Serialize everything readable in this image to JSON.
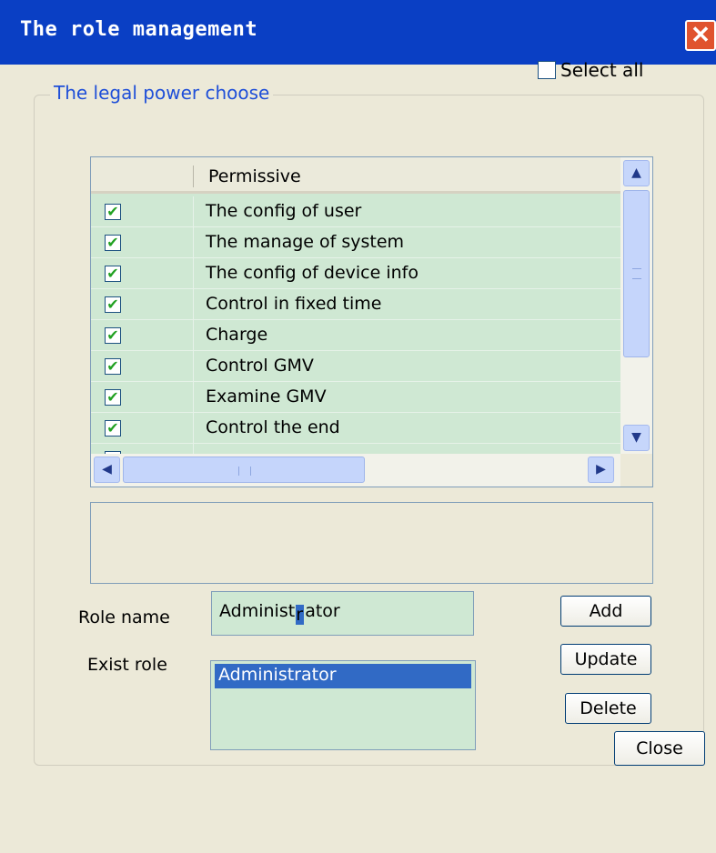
{
  "window": {
    "title": "The role management",
    "close_glyph": "✕"
  },
  "group": {
    "legend": "The legal power choose",
    "select_all_label": "Select all",
    "select_all_checked": false
  },
  "permissions": {
    "column_header": "Permissive",
    "items": [
      {
        "label": "The config of user",
        "checked": true
      },
      {
        "label": "The manage of system",
        "checked": true
      },
      {
        "label": "The config of device info",
        "checked": true
      },
      {
        "label": "Control in fixed time",
        "checked": true
      },
      {
        "label": "Charge",
        "checked": true
      },
      {
        "label": "Control GMV",
        "checked": true
      },
      {
        "label": "Examine GMV",
        "checked": true
      },
      {
        "label": "Control the end",
        "checked": true
      }
    ],
    "check_glyph": "✔"
  },
  "scrollbars": {
    "up_glyph": "▲",
    "down_glyph": "▼",
    "left_glyph": "◀",
    "right_glyph": "▶"
  },
  "form": {
    "role_name_label": "Role name",
    "role_name_before_caret": "Administ",
    "role_name_selected": "r",
    "role_name_after_caret": "ator",
    "exist_role_label": "Exist role",
    "exist_roles": [
      "Administrator"
    ]
  },
  "buttons": {
    "add": "Add",
    "update": "Update",
    "delete": "Delete",
    "close": "Close"
  },
  "colors": {
    "title_bar": "#0a3fc4",
    "dialog_bg": "#ece9d8",
    "list_bg": "#cfe8d3",
    "selection": "#316ac5",
    "legend_text": "#1f4fd8"
  }
}
